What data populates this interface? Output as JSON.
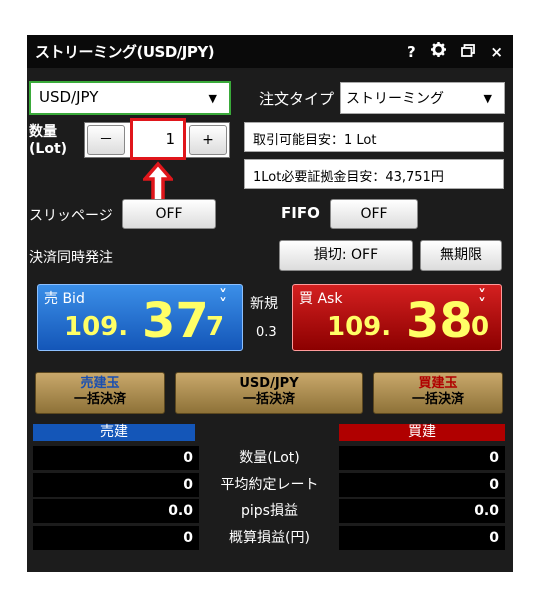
{
  "window": {
    "title": "ストリーミング(USD/JPY)",
    "help_icon": "?",
    "gear_icon": "gear-icon",
    "restore_icon": "restore-icon",
    "close_icon": "×"
  },
  "symbol_select": {
    "value": "USD/JPY"
  },
  "order_type": {
    "label": "注文タイプ",
    "value": "ストリーミング"
  },
  "quantity": {
    "label_1": "数量",
    "label_2": "(Lot)",
    "minus": "－",
    "value": "1",
    "plus": "+"
  },
  "info": {
    "tradable": "取引可能目安：1 Lot",
    "margin": "1Lot必要証拠金目安：43,751円"
  },
  "slippage": {
    "label": "スリッページ",
    "value": "OFF"
  },
  "fifo": {
    "label": "FIFO",
    "value": "OFF"
  },
  "settlement": {
    "label": "決済同時発注",
    "stop_loss": "損切: OFF",
    "expiry": "無期限"
  },
  "bid": {
    "label": "売 Bid",
    "big_figure": "109.",
    "pips": "37",
    "fraction": "7"
  },
  "new_position": {
    "label": "新規",
    "spread": "0.3"
  },
  "ask": {
    "label": "買 Ask",
    "big_figure": "109.",
    "pips": "38",
    "fraction": "0"
  },
  "bulk_buttons": {
    "sell": {
      "line1": "売建玉",
      "line2": "一括決済"
    },
    "pair": {
      "line1": "USD/JPY",
      "line2": "一括決済"
    },
    "buy": {
      "line1": "買建玉",
      "line2": "一括決済"
    }
  },
  "positions": {
    "sell_header": "売建",
    "buy_header": "買建",
    "rows": [
      {
        "label": "数量(Lot)",
        "sell": "0",
        "buy": "0"
      },
      {
        "label": "平均約定レート",
        "sell": "0",
        "buy": "0"
      },
      {
        "label": "pips損益",
        "sell": "0.0",
        "buy": "0.0"
      },
      {
        "label": "概算損益(円)",
        "sell": "0",
        "buy": "0"
      }
    ]
  },
  "colors": {
    "bid": "#1456b8",
    "ask": "#b00000",
    "highlight": "#e0161b",
    "price": "#ffff66"
  }
}
